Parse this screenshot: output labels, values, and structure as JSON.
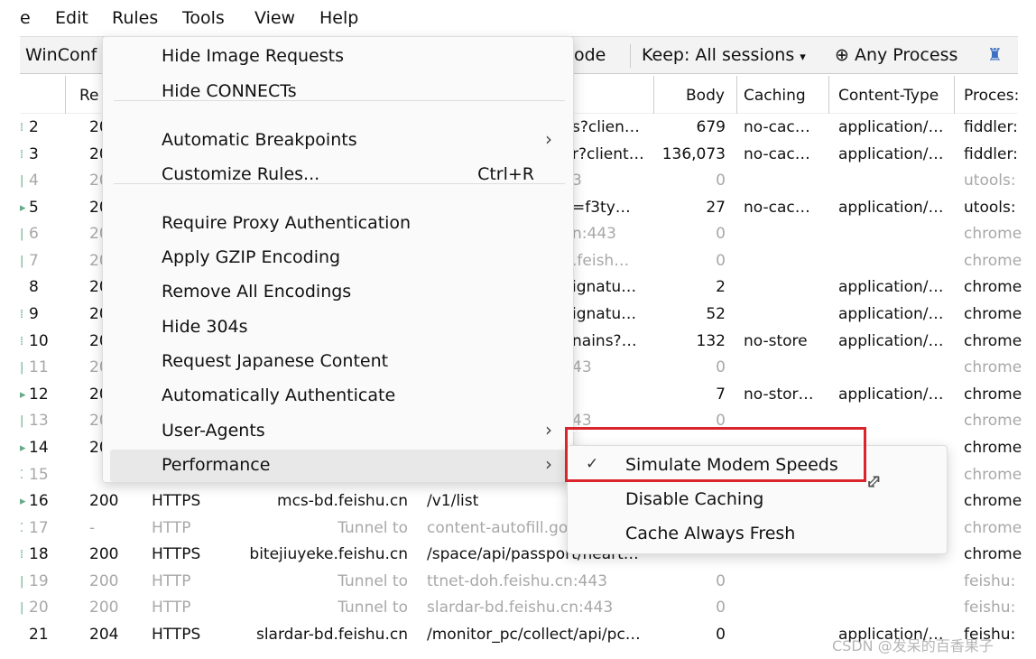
{
  "menubar": {
    "items": [
      "e",
      "Edit",
      "Rules",
      "Tools",
      "View",
      "Help"
    ]
  },
  "toolbar": {
    "winconfig": "WinConf",
    "decode_fragment": "ode",
    "keep": "Keep: All sessions",
    "keep_arrow": "▾",
    "process": "Any Process",
    "find_icon": "binoculars-icon"
  },
  "columns": {
    "result": "Re",
    "body": "Body",
    "caching": "Caching",
    "content_type": "Content-Type",
    "process": "Proces:"
  },
  "rows": [
    {
      "num": "2",
      "marker": "⁞",
      "result": "20",
      "url": "s?clien…",
      "body": "679",
      "caching": "no-cac…",
      "ctype": "application/…",
      "process": "fiddler:",
      "dim": false
    },
    {
      "num": "3",
      "marker": "⁞",
      "result": "20",
      "url": "r?client…",
      "body": "136,073",
      "caching": "no-cac…",
      "ctype": "application/…",
      "process": "fiddler:",
      "dim": false
    },
    {
      "num": "4",
      "marker": "|",
      "result": "20",
      "url": "3",
      "body": "0",
      "caching": "",
      "ctype": "",
      "process": "utools:",
      "dim": true
    },
    {
      "num": "5",
      "marker": "▸",
      "result": "20",
      "url": "=f3ty…",
      "body": "27",
      "caching": "no-cac…",
      "ctype": "application/…",
      "process": "utools:",
      "dim": false
    },
    {
      "num": "6",
      "marker": "|",
      "result": "20",
      "url": "n:443",
      "body": "0",
      "caching": "",
      "ctype": "",
      "process": "chrome",
      "dim": true
    },
    {
      "num": "7",
      "marker": "|",
      "result": "20",
      "url": ".feish…",
      "body": "0",
      "caching": "",
      "ctype": "",
      "process": "chrome",
      "dim": true
    },
    {
      "num": "8",
      "marker": "",
      "result": "20",
      "url": "ignatu…",
      "body": "2",
      "caching": "",
      "ctype": "application/…",
      "process": "chrome",
      "dim": false
    },
    {
      "num": "9",
      "marker": "⁞",
      "result": "20",
      "url": "ignatu…",
      "body": "52",
      "caching": "",
      "ctype": "application/…",
      "process": "chrome",
      "dim": false
    },
    {
      "num": "10",
      "marker": "⁞",
      "result": "20",
      "url": "nains?…",
      "body": "132",
      "caching": "no-store",
      "ctype": "application/…",
      "process": "chrome",
      "dim": false
    },
    {
      "num": "11",
      "marker": "|",
      "result": "20",
      "url": "43",
      "body": "0",
      "caching": "",
      "ctype": "",
      "process": "chrome",
      "dim": true
    },
    {
      "num": "12",
      "marker": "▸",
      "result": "20",
      "url": "",
      "body": "7",
      "caching": "no-stor…",
      "ctype": "application/…",
      "process": "chrome",
      "dim": false
    },
    {
      "num": "13",
      "marker": "|",
      "result": "20",
      "url": "43",
      "body": "0",
      "caching": "",
      "ctype": "",
      "process": "chrome",
      "dim": true
    },
    {
      "num": "14",
      "marker": "▸",
      "result": "20",
      "url": "",
      "body": "",
      "caching": "",
      "ctype": "",
      "process": "chrome",
      "dim": false
    },
    {
      "num": "15",
      "marker": "⁚",
      "result": "",
      "url": "",
      "body": "",
      "caching": "",
      "ctype": "",
      "process": "chrome",
      "dim": true
    },
    {
      "num": "16",
      "marker": "▸",
      "result": "200",
      "protocol": "HTTPS",
      "host": "mcs-bd.feishu.cn",
      "url": "/v1/list",
      "body": "",
      "caching": "",
      "ctype": "",
      "process": "chrome",
      "dim": false
    },
    {
      "num": "17",
      "marker": "⁚",
      "result": "-",
      "protocol": "HTTP",
      "host": "Tunnel to",
      "url": "content-autofill.go",
      "body": "",
      "caching": "",
      "ctype": "",
      "process": "chrome",
      "dim": true
    },
    {
      "num": "18",
      "marker": "⁞",
      "result": "200",
      "protocol": "HTTPS",
      "host": "bitejiuyeke.feishu.cn",
      "url": "/space/api/passport/heart…",
      "body": "",
      "caching": "",
      "ctype": "",
      "process": "chrome",
      "dim": false
    },
    {
      "num": "19",
      "marker": "|",
      "result": "200",
      "protocol": "HTTP",
      "host": "Tunnel to",
      "url": "ttnet-doh.feishu.cn:443",
      "body": "0",
      "caching": "",
      "ctype": "",
      "process": "feishu:",
      "dim": true
    },
    {
      "num": "20",
      "marker": "|",
      "result": "200",
      "protocol": "HTTP",
      "host": "Tunnel to",
      "url": "slardar-bd.feishu.cn:443",
      "body": "0",
      "caching": "",
      "ctype": "",
      "process": "feishu:",
      "dim": true
    },
    {
      "num": "21",
      "marker": "",
      "result": "204",
      "protocol": "HTTPS",
      "host": "slardar-bd.feishu.cn",
      "url": "/monitor_pc/collect/api/pc…",
      "body": "0",
      "caching": "",
      "ctype": "application/…",
      "process": "feishu:",
      "dim": false
    }
  ],
  "rules_menu": {
    "items": [
      {
        "label": "Hide Image Requests"
      },
      {
        "label": "Hide CONNECTs"
      },
      {
        "label": "Automatic Breakpoints",
        "submenu": true
      },
      {
        "label": "Customize Rules...",
        "shortcut": "Ctrl+R"
      },
      {
        "label": "Require Proxy Authentication"
      },
      {
        "label": "Apply GZIP Encoding"
      },
      {
        "label": "Remove All Encodings"
      },
      {
        "label": "Hide 304s"
      },
      {
        "label": "Request Japanese Content"
      },
      {
        "label": "Automatically Authenticate"
      },
      {
        "label": "User-Agents",
        "submenu": true
      },
      {
        "label": "Performance",
        "submenu": true,
        "highlighted": true
      }
    ]
  },
  "performance_submenu": {
    "items": [
      {
        "label": "Simulate Modem Speeds",
        "checked": true
      },
      {
        "label": "Disable Caching",
        "checked": false
      },
      {
        "label": "Cache Always Fresh",
        "checked": false
      }
    ]
  },
  "highlight_color": "#d9252b",
  "watermark": "CSDN @发呆的百香果子"
}
